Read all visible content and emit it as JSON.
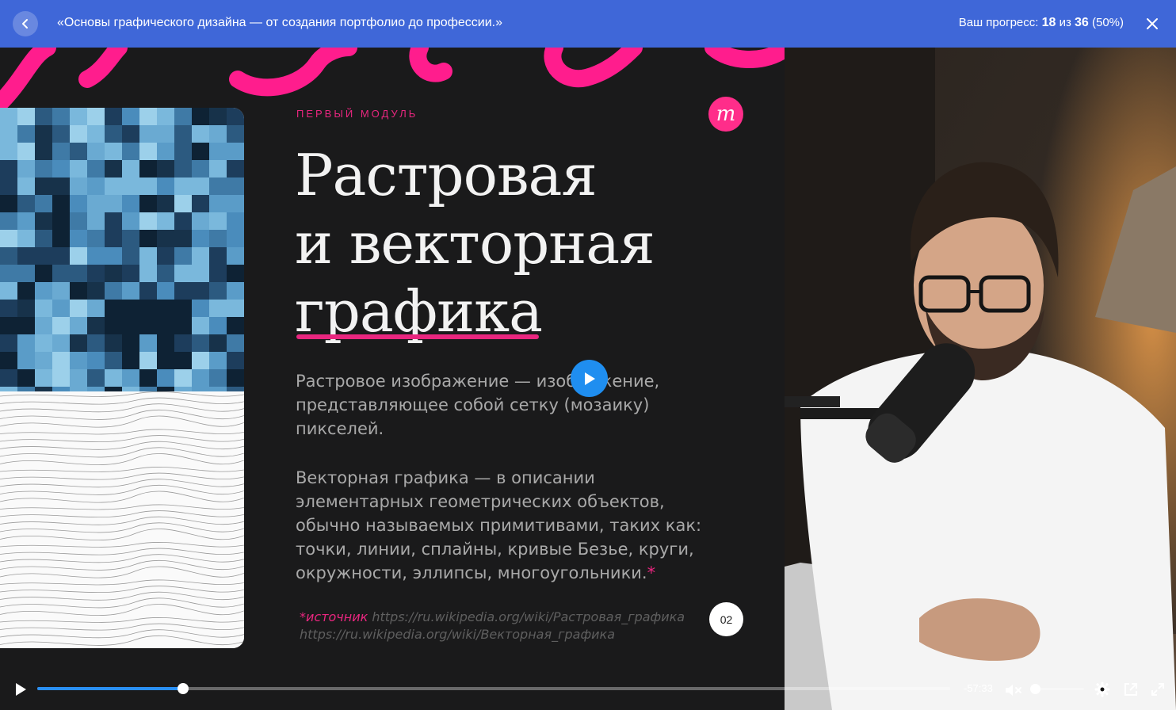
{
  "header": {
    "course_title": "«Основы графического дизайна — от создания портфолио до профессии.»",
    "progress_prefix": "Ваш прогресс:",
    "progress_done": "18",
    "progress_word": "из",
    "progress_total": "36",
    "progress_percent": "(50%)"
  },
  "slide": {
    "module_label": "ПЕРВЫЙ МОДУЛЬ",
    "logo_letter": "m",
    "title_lines": [
      "Растровая",
      "и векторная",
      "графика"
    ],
    "paragraph1": "Растровое изображение — изображение, представляющее собой сетку (мозаику) пикселей.",
    "paragraph2": "Векторная графика — в описании элементарных геометрических объектов, обычно называемых примитивами, таких как: точки, линии, сплайны, кривые Безье, круги, окружности, эллипсы, многоугольники.",
    "asterisk": "*",
    "source_label": "*источник",
    "source_url1": "https://ru.wikipedia.org/wiki/Растровая_графика",
    "source_url2": "https://ru.wikipedia.org/wiki/Векторная_графика",
    "page_number": "02"
  },
  "player": {
    "time_remaining": "-57:33",
    "progress_fraction": 0.16,
    "volume_fraction": 0.0,
    "muted": true
  },
  "colors": {
    "topbar": "#3f67d8",
    "accent_pink": "#e9267f",
    "play_blue": "#1f8ef0"
  },
  "icons": {
    "back": "chevron-left-icon",
    "close": "close-icon",
    "play": "play-icon",
    "mute": "volume-muted-icon",
    "settings": "gear-icon",
    "popout": "external-link-icon",
    "fullscreen": "fullscreen-icon"
  }
}
